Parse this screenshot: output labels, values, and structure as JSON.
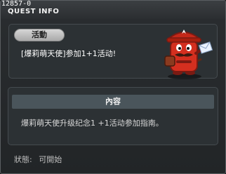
{
  "window": {
    "quest_id": "12857-0",
    "title": "QUEST INFO"
  },
  "quest": {
    "tag": "活動",
    "name": "[爆莉萌天使]参加1+1活动!"
  },
  "content": {
    "header": "內容",
    "body": "爆莉萌天使升级纪念1 +1活动参加指南。"
  },
  "status": {
    "label": "狀態:",
    "value": "可開始"
  },
  "npc": {
    "icon": "red-mailbox-npc-icon",
    "colors": {
      "body": "#d42f1f",
      "dark": "#7b1a12",
      "letter": "#eaf3ff"
    }
  }
}
